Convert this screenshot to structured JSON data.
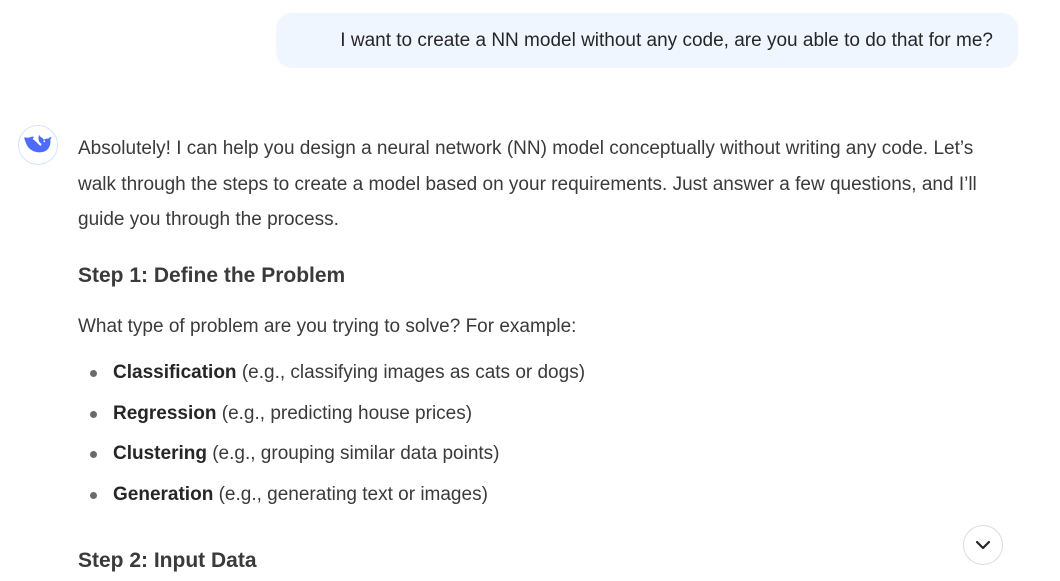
{
  "user_message": "I want to create a NN model without any code, are you able to do that for me?",
  "assistant": {
    "avatar_icon": "whale-logo-icon",
    "intro": "Absolutely! I can help you design a neural network (NN) model conceptually without writing any code. Let’s walk through the steps to create a model based on your requirements. Just answer a few questions, and I’ll guide you through the process.",
    "step1_heading": "Step 1: Define the Problem",
    "step1_prompt": "What type of problem are you trying to solve? For example:",
    "options": [
      {
        "term": "Classification",
        "desc": " (e.g., classifying images as cats or dogs)"
      },
      {
        "term": "Regression",
        "desc": " (e.g., predicting house prices)"
      },
      {
        "term": "Clustering",
        "desc": " (e.g., grouping similar data points)"
      },
      {
        "term": "Generation",
        "desc": " (e.g., generating text or images)"
      }
    ],
    "step2_heading": "Step 2: Input Data"
  },
  "scroll_button_icon": "chevron-down-icon",
  "colors": {
    "user_bubble": "#eff6ff",
    "brand": "#4d6bfe",
    "text": "#3a3a3a"
  }
}
